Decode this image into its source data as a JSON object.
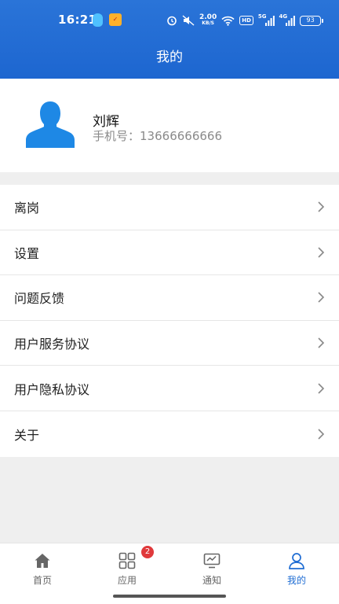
{
  "status_bar": {
    "time": "16:21",
    "net_speed": "2.00",
    "net_speed_unit": "KB/S",
    "hd_label": "HD",
    "sim1_label": "5G",
    "sim2_label": "4G",
    "battery": "93",
    "notification_icons": [
      "qq-icon",
      "app-badge-icon"
    ],
    "system_icons": [
      "alarm-icon",
      "mute-icon",
      "wifi-icon",
      "signal-icon",
      "signal-icon"
    ]
  },
  "header": {
    "title": "我的",
    "background_color": "#1f69d2"
  },
  "profile": {
    "name": "刘辉",
    "phone_label": "手机号：",
    "phone": "13666666666",
    "avatar_icon": "user-silhouette-icon",
    "avatar_color": "#1e88e5"
  },
  "menu": {
    "items": [
      {
        "label": "离岗"
      },
      {
        "label": "设置"
      },
      {
        "label": "问题反馈"
      },
      {
        "label": "用户服务协议"
      },
      {
        "label": "用户隐私协议"
      },
      {
        "label": "关于"
      }
    ]
  },
  "bottom_nav": {
    "items": [
      {
        "label": "首页",
        "icon": "home-icon"
      },
      {
        "label": "应用",
        "icon": "apps-grid-icon",
        "badge": "2"
      },
      {
        "label": "通知",
        "icon": "monitor-chart-icon"
      },
      {
        "label": "我的",
        "icon": "person-icon",
        "active": true
      }
    ],
    "active_color": "#1e6cd3",
    "badge_color": "#e0393b"
  }
}
